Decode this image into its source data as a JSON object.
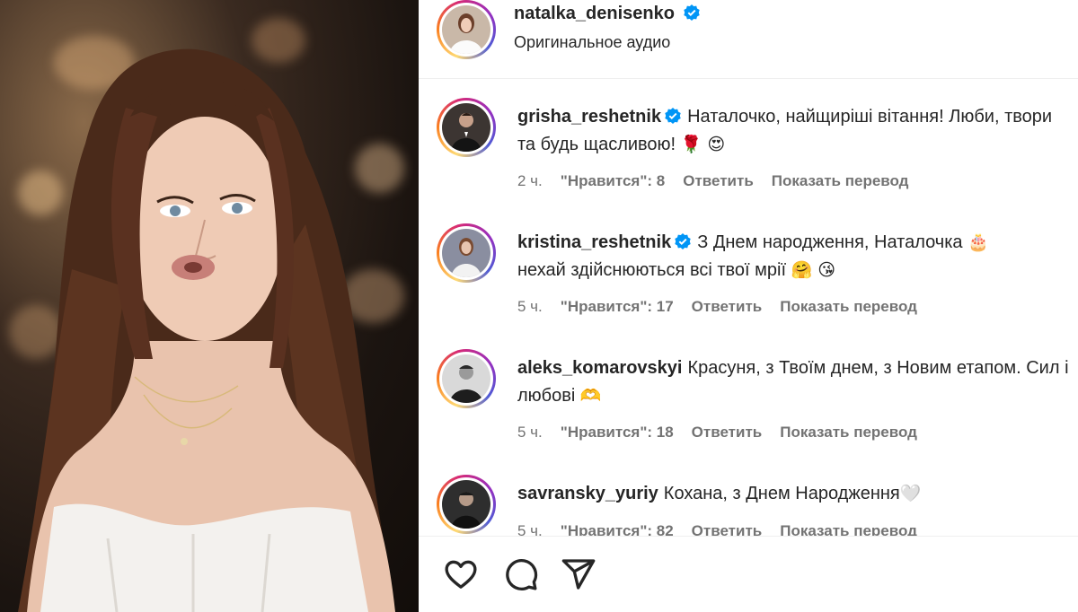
{
  "post": {
    "author": "natalka_denisenko",
    "audio": "Оригинальное аудио",
    "verified": true
  },
  "comments": [
    {
      "username": "grisha_reshetnik",
      "verified": true,
      "text": "Наталочко, найщиріші вітання! Люби, твори та будь щасливою!",
      "emojis": "🌹 😍",
      "time": "2 ч.",
      "likes": "\"Нравится\": 8",
      "reply": "Ответить",
      "translate": "Показать перевод"
    },
    {
      "username": "kristina_reshetnik",
      "verified": true,
      "text": "З Днем народження, Наталочка",
      "text_cont": "нехай здійснюються всі твої мрії",
      "emoji_inline": "🎂",
      "emojis": "🤗 😘",
      "time": "5 ч.",
      "likes": "\"Нравится\": 17",
      "reply": "Ответить",
      "translate": "Показать перевод"
    },
    {
      "username": "aleks_komarovskyi",
      "verified": false,
      "text": "Красуня, з Твоїм днем, з Новим етапом. Сил і любові",
      "emojis": "🫶",
      "time": "5 ч.",
      "likes": "\"Нравится\": 18",
      "reply": "Ответить",
      "translate": "Показать перевод"
    },
    {
      "username": "savransky_yuriy",
      "verified": false,
      "text": "Кохана, з Днем Народження",
      "emojis": "🤍",
      "time": "5 ч.",
      "likes": "\"Нравится\": 82",
      "reply": "Ответить",
      "translate": "Показать перевод"
    }
  ],
  "actions": {
    "like_icon": "heart-icon",
    "comment_icon": "comment-icon",
    "share_icon": "share-icon"
  },
  "colors": {
    "verified": "#0095f6",
    "meta": "#737373",
    "text": "#262626"
  }
}
